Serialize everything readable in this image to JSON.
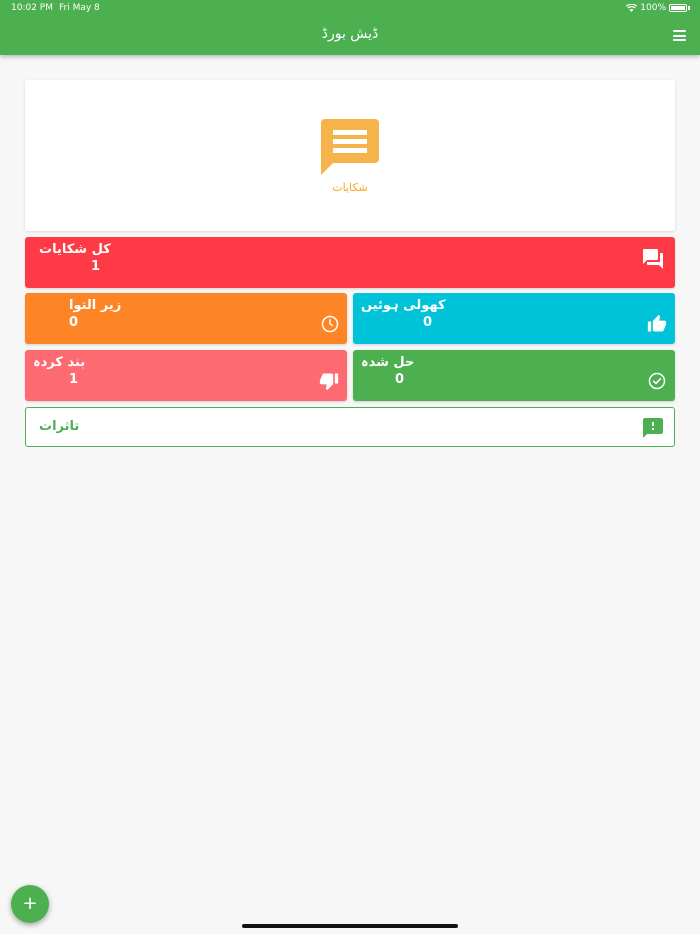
{
  "status_bar": {
    "time": "10:02 PM",
    "date": "Fri May 8",
    "battery": "100%"
  },
  "header": {
    "title": "ڈیش بورڈ",
    "menu_icon": "hamburger-menu-icon"
  },
  "main_card": {
    "icon": "chat-lines-icon",
    "label": "شکایات",
    "accent_color": "#f5a623"
  },
  "tiles": {
    "total": {
      "label": "کل شکایات",
      "value": "1",
      "icon": "forum-icon",
      "color": "#fe3a47"
    },
    "in_progress": {
      "label": "زیر التوا",
      "value": "0",
      "icon": "clock-icon",
      "color": "#fd8526"
    },
    "open": {
      "label": "کھولی ہوئیں",
      "value": "0",
      "icon": "thumbs-up-icon",
      "color": "#00c3d9"
    },
    "closed": {
      "label": "بند کردہ",
      "value": "1",
      "icon": "thumbs-down-icon",
      "color": "#fd6a72"
    },
    "resolved": {
      "label": "حل شدہ",
      "value": "0",
      "icon": "check-circle-icon",
      "color": "#4caf50"
    }
  },
  "feedback": {
    "label": "تاثرات",
    "icon": "feedback-icon"
  },
  "fab": {
    "label": "+"
  },
  "colors": {
    "primary": "#4caf50",
    "background": "#f7f7f7"
  }
}
